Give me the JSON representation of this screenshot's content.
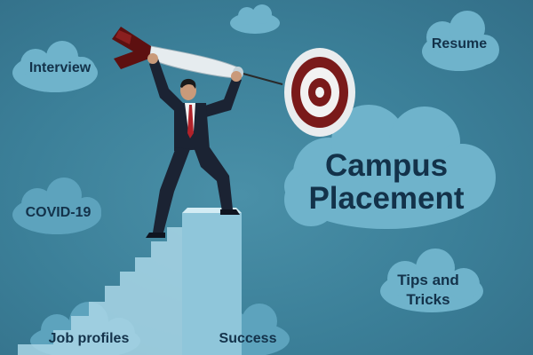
{
  "scene": {
    "clouds": {
      "interview": "Interview",
      "resume": "Resume",
      "covid": "COVID-19",
      "tips": "Tips and Tricks",
      "jobs": "Job profiles",
      "success": "Success"
    },
    "title": "Campus Placement"
  },
  "colors": {
    "background": "#3b7f98",
    "cloud": "#6fb3cb",
    "text": "#13324a",
    "target_red": "#7a1a1a",
    "suit": "#1b2333",
    "tie": "#b0222a"
  },
  "icons": [
    "dart-icon",
    "target-icon",
    "businessman-figure",
    "staircase"
  ]
}
